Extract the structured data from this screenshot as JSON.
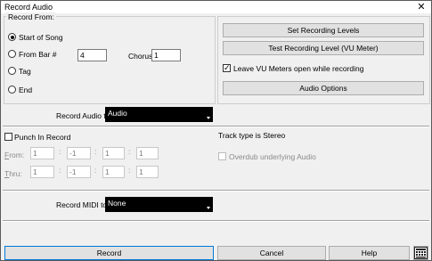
{
  "window": {
    "title": "Record Audio",
    "close_glyph": "✕"
  },
  "record_from": {
    "group_label": "Record From:",
    "options": [
      {
        "label": "Start of Song",
        "checked": true
      },
      {
        "label": "From Bar #",
        "checked": false
      },
      {
        "label": "Tag",
        "checked": false
      },
      {
        "label": "End",
        "checked": false
      }
    ],
    "bar_value": "4",
    "chorus_label": "Chorus",
    "chorus_value": "1"
  },
  "right_panel": {
    "set_levels_label": "Set Recording Levels",
    "test_level_label": "Test Recording Level (VU Meter)",
    "leave_vu_label": "Leave VU Meters open while recording",
    "leave_vu_checked": true,
    "audio_options_label": "Audio Options"
  },
  "record_audio_to": {
    "label": "Record Audio to:",
    "value": "Audio"
  },
  "punch_in": {
    "label": "Punch In Record",
    "checked": false,
    "from_label": "From:",
    "thru_label": "Thru:",
    "from_values": [
      "1",
      "-1",
      "1",
      "1"
    ],
    "thru_values": [
      "1",
      "-1",
      "1",
      "1"
    ],
    "separator": ":"
  },
  "track_type": {
    "text": "Track type is Stereo",
    "overdub_label": "Overdub underlying Audio",
    "overdub_checked": false
  },
  "record_midi_to": {
    "label": "Record MIDI to:",
    "value": "None"
  },
  "footer": {
    "record_label": "Record",
    "cancel_label": "Cancel",
    "help_label": "Help",
    "extra_icon": "keyboard-icon"
  }
}
